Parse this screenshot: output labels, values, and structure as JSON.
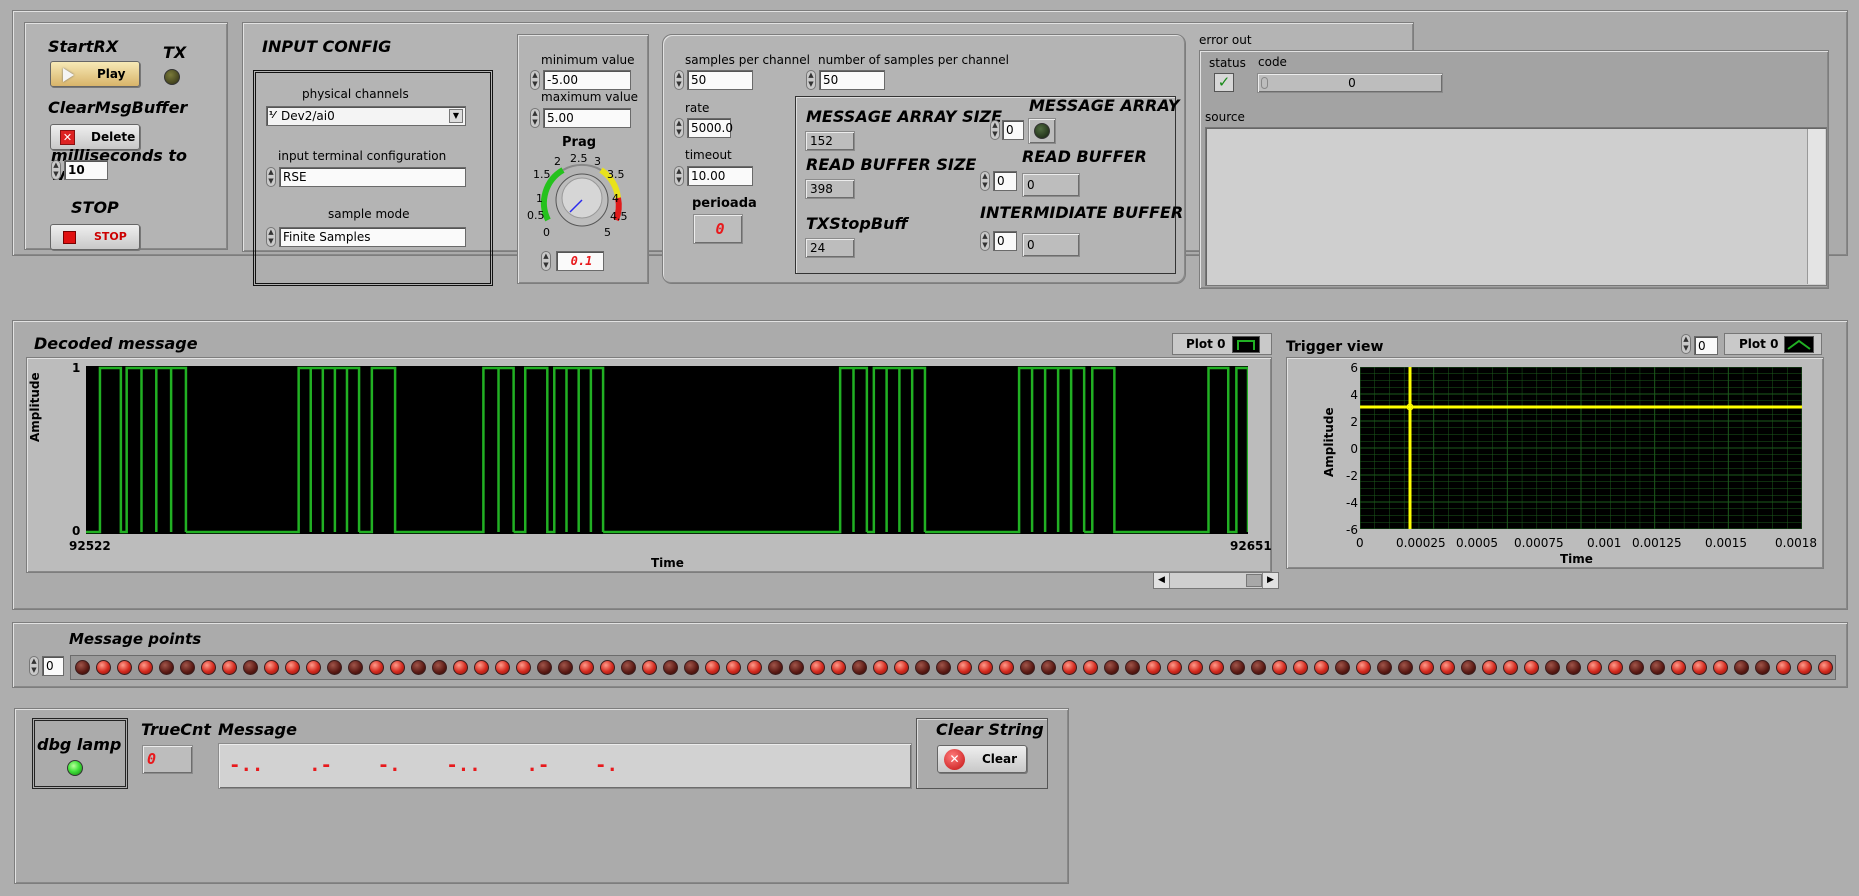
{
  "controls": {
    "startrx_label": "StartRX",
    "play_label": "Play",
    "tx_label": "TX",
    "clearmsg_label": "ClearMsgBuffer",
    "delete_label": "Delete",
    "ms_wait_label": "milliseconds to wait",
    "ms_wait_value": "10",
    "stop_label": "STOP",
    "stop_button_label": "STOP"
  },
  "input_config": {
    "title": "INPUT CONFIG",
    "physical_channels_label": "physical channels",
    "physical_channels_value": "Dev2/ai0",
    "terminal_label": "input terminal configuration",
    "terminal_value": "RSE",
    "sample_mode_label": "sample mode",
    "sample_mode_value": "Finite Samples"
  },
  "range": {
    "min_label": "minimum value",
    "min_value": "-5.00",
    "max_label": "maximum value",
    "max_value": "5.00",
    "knob_label": "Prag",
    "knob_ticks": [
      "0",
      "0.5",
      "1",
      "1.5",
      "2",
      "2.5",
      "3",
      "3.5",
      "4",
      "4.5",
      "5"
    ],
    "knob_level": 0.1,
    "knob_value": "0.1"
  },
  "timing": {
    "samples_per_channel_label": "samples per channel",
    "samples_per_channel_value": "50",
    "num_samples_label": "number of samples per channel",
    "num_samples_value": "50",
    "rate_label": "rate",
    "rate_value": "5000.0",
    "timeout_label": "timeout",
    "timeout_value": "10.00",
    "perioada_label": "perioada",
    "perioada_value": "0"
  },
  "buffers": {
    "msg_array_size_label": "MESSAGE ARRAY SIZE",
    "msg_array_size_value": "152",
    "read_buffer_size_label": "READ BUFFER SIZE",
    "read_buffer_size_value": "398",
    "txstopbuff_label": "TXStopBuff",
    "txstopbuff_value": "24",
    "msg_array_label": "MESSAGE ARRAY",
    "msg_array_index": "0",
    "read_buffer_label": "READ BUFFER",
    "read_buffer_index": "0",
    "read_buffer_value": "0",
    "intermediate_label": "INTERMIDIATE BUFFER",
    "intermediate_index": "0",
    "intermediate_value": "0"
  },
  "error_out": {
    "title": "error out",
    "status_label": "status",
    "code_label": "code",
    "code_value": "0",
    "source_label": "source"
  },
  "decoded": {
    "title": "Decoded message",
    "plot_legend": "Plot 0",
    "ylabel": "Amplitude",
    "xlabel": "Time",
    "y_top": "1",
    "y_bottom": "0",
    "x_start": "92522",
    "x_end": "92651"
  },
  "trigger": {
    "title": "Trigger view",
    "plot_legend": "Plot 0",
    "index_value": "0",
    "ylabel": "Amplitude",
    "xlabel": "Time",
    "y_ticks": [
      "6",
      "4",
      "2",
      "0",
      "-2",
      "-4",
      "-6"
    ],
    "x_ticks": [
      "0",
      "0.00025",
      "0.0005",
      "0.00075",
      "0.001",
      "0.00125",
      "0.0015",
      "0.0018"
    ]
  },
  "message_points": {
    "title": "Message points",
    "index_value": "0",
    "states": [
      0,
      1,
      1,
      1,
      0,
      0,
      1,
      1,
      0,
      1,
      1,
      1,
      0,
      0,
      1,
      1,
      0,
      0,
      1,
      1,
      1,
      1,
      0,
      0,
      1,
      1,
      0,
      1,
      0,
      0,
      1,
      1,
      1,
      0,
      0,
      1,
      1,
      0,
      1,
      1,
      0,
      0,
      1,
      1,
      1,
      0,
      0,
      1,
      1,
      0,
      0,
      1,
      1,
      1,
      1,
      0,
      0,
      1,
      1,
      1,
      0,
      1,
      0,
      0,
      1,
      1,
      0,
      1,
      1,
      1,
      0,
      0,
      1,
      1,
      0,
      0,
      1,
      1,
      1,
      0,
      0,
      1,
      1,
      1
    ]
  },
  "bottom": {
    "dbg_lamp_label": "dbg lamp",
    "truecnt_label": "TrueCnt",
    "truecnt_value": "0",
    "message_label": "Message",
    "message_value": "-..    .-    -.    -..    .-    -.",
    "clear_string_label": "Clear String",
    "clear_button_label": "Clear"
  },
  "colors": {
    "plot_bg": "#000000",
    "decoded_trace": "#21b023",
    "trigger_trace": "#ffff00",
    "trigger_grid": "#1c5a1c",
    "led_red": "#d42a1e",
    "led_dark": "#5b1a14",
    "lamp_green": "#41e23a",
    "indicator_red_text": "#e8191c"
  }
}
